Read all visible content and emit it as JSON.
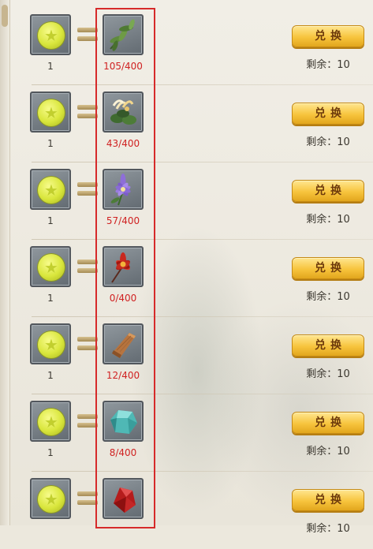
{
  "exchange_list": {
    "rows": [
      {
        "cost": "1",
        "item_icon": "fern-leaves-icon",
        "owned": "105/400",
        "button_label": "兑换",
        "remaining": "剩余：10"
      },
      {
        "cost": "1",
        "item_icon": "honeysuckle-flower-icon",
        "owned": "43/400",
        "button_label": "兑换",
        "remaining": "剩余：10"
      },
      {
        "cost": "1",
        "item_icon": "purple-flower-icon",
        "owned": "57/400",
        "button_label": "兑换",
        "remaining": "剩余：10"
      },
      {
        "cost": "1",
        "item_icon": "red-lotus-icon",
        "owned": "0/400",
        "button_label": "兑换",
        "remaining": "剩余：10"
      },
      {
        "cost": "1",
        "item_icon": "wood-plank-icon",
        "owned": "12/400",
        "button_label": "兑换",
        "remaining": "剩余：10"
      },
      {
        "cost": "1",
        "item_icon": "jade-stone-icon",
        "owned": "8/400",
        "button_label": "兑换",
        "remaining": "剩余：10"
      },
      {
        "cost": "",
        "item_icon": "red-crystal-icon",
        "owned": "",
        "button_label": "兑换",
        "remaining": "剩余：10"
      }
    ]
  },
  "colors": {
    "owned_count": "#d02222",
    "highlight_box": "#d62a2a",
    "button_gold": "#f7c43d",
    "button_text": "#6e3b0c"
  }
}
